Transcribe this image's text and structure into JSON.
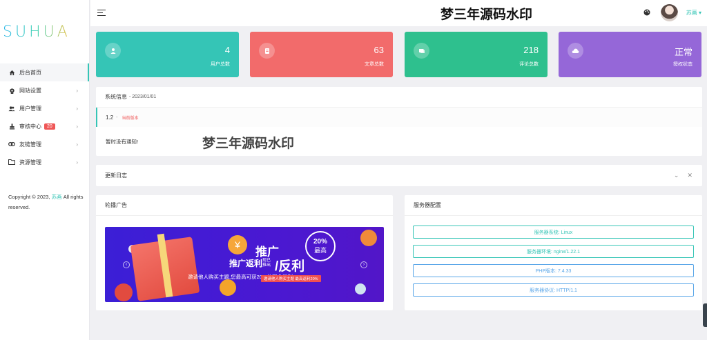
{
  "sidebar": {
    "logo": "SUHUA",
    "items": [
      {
        "label": "后台首页",
        "icon": "home-icon",
        "active": true
      },
      {
        "label": "网站设置",
        "icon": "gear-icon"
      },
      {
        "label": "用户管理",
        "icon": "users-icon"
      },
      {
        "label": "审核中心",
        "icon": "stamp-icon",
        "badge": "20"
      },
      {
        "label": "友链管理",
        "icon": "link-icon"
      },
      {
        "label": "资源管理",
        "icon": "folder-icon"
      }
    ],
    "copyright_prefix": "Copyright © 2023,",
    "copyright_brand": "苏画",
    "copyright_suffix": "All rights reserved."
  },
  "header": {
    "watermark": "梦三年源码水印",
    "user_name": "苏画 ▾"
  },
  "stats": [
    {
      "value": "4",
      "label": "用户总数",
      "color": "#35c5b6",
      "icon": "user-icon"
    },
    {
      "value": "63",
      "label": "文章总数",
      "color": "#f26b6b",
      "icon": "article-icon"
    },
    {
      "value": "218",
      "label": "评论总数",
      "color": "#2ec08e",
      "icon": "comment-icon"
    },
    {
      "value": "正常",
      "label": "授权状态",
      "color": "#9567d8",
      "icon": "cloud-icon"
    }
  ],
  "system_info": {
    "title": "系统信息",
    "date": "- 2023/01/01",
    "version": "1.2",
    "version_sep": "-",
    "version_tag": "当前版本",
    "notice": "暂时没有通知!",
    "watermark": "梦三年源码水印"
  },
  "changelog": {
    "title": "更新日志"
  },
  "carousel": {
    "title": "轮播广告",
    "headline": "推广",
    "sub_left": "推广返利",
    "sub_small": "现已推出",
    "sub_right": "/反利",
    "percent": "20%",
    "percent_label": "最高",
    "description": "邀请他人购买主题,您最高可获20%的现金返利",
    "tag": "邀请他人购买主题 最高返利20%"
  },
  "server": {
    "title": "服务器配置",
    "rows": [
      "服务器系统: Linux",
      "服务器环境: nginx/1.22.1",
      "PHP版本: 7.4.33",
      "服务器协议: HTTP/1.1"
    ]
  }
}
